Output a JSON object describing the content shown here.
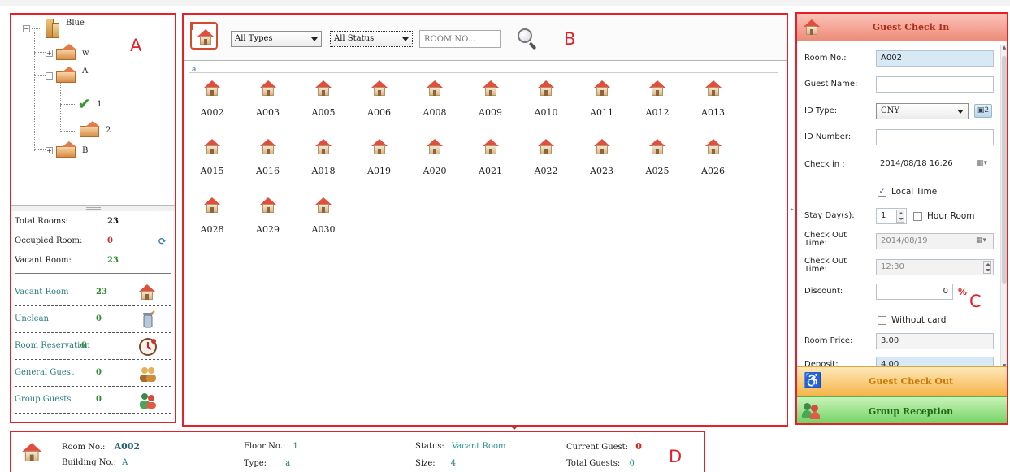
{
  "tree": {
    "building": "Blue",
    "floors": [
      {
        "label": "w"
      },
      {
        "label": "A"
      },
      {
        "label": "1"
      },
      {
        "label": "2"
      },
      {
        "label": "B"
      }
    ]
  },
  "summary": {
    "total_rooms_label": "Total Rooms:",
    "total_rooms": "23",
    "occupied_label": "Occupied Room:",
    "occupied": "0",
    "vacant_label": "Vacant Room:",
    "vacant": "23"
  },
  "categories": [
    {
      "label": "Vacant Room",
      "count": "23",
      "icon": "house-icon"
    },
    {
      "label": "Unclean",
      "count": "0",
      "icon": "trash-icon"
    },
    {
      "label": "Room Reservation",
      "count": "0",
      "icon": "clock-icon"
    },
    {
      "label": "General Guest",
      "count": "0",
      "icon": "guests-icon"
    },
    {
      "label": "Group Guests",
      "count": "0",
      "icon": "group-icon"
    }
  ],
  "toolbar": {
    "type_select": "All Types",
    "status_select": "All Status",
    "room_placeholder": "ROOM NO..."
  },
  "room_group": "a",
  "rooms": [
    "A002",
    "A003",
    "A005",
    "A006",
    "A008",
    "A009",
    "A010",
    "A011",
    "A012",
    "A013",
    "A015",
    "A016",
    "A018",
    "A019",
    "A020",
    "A021",
    "A022",
    "A023",
    "A025",
    "A026",
    "A028",
    "A029",
    "A030"
  ],
  "checkin": {
    "title": "Guest Check In",
    "room_no_label": "Room No.:",
    "room_no": "A002",
    "guest_name_label": "Guest Name:",
    "guest_name": "",
    "id_type_label": "ID Type:",
    "id_type": "CNY",
    "id_number_label": "ID Number:",
    "id_number": "",
    "check_in_label": "Check in :",
    "check_in": "2014/08/18 16:26",
    "local_time_label": "Local Time",
    "stay_days_label": "Stay Day(s):",
    "stay_days": "1",
    "hour_room_label": "Hour Room",
    "check_out_date_label": "Check Out Time:",
    "check_out_date": "2014/08/19",
    "check_out_time_label": "Check Out Time:",
    "check_out_time": "12:30",
    "discount_label": "Discount:",
    "discount": "0",
    "percent_sign": "%",
    "without_card_label": "Without card",
    "room_price_label": "Room Price:",
    "room_price": "3.00",
    "deposit_label": "Deposit:",
    "deposit": "4.00"
  },
  "checkout": {
    "title": "Guest Check Out"
  },
  "group_reception": {
    "title": "Group Reception"
  },
  "details": {
    "room_no_label": "Room No.:",
    "room_no": "A002",
    "building_no_label": "Building No.:",
    "building_no": "A",
    "floor_no_label": "Floor No.:",
    "floor_no": "1",
    "type_label": "Type:",
    "type": "a",
    "status_label": "Status:",
    "status": "Vacant Room",
    "size_label": "Size:",
    "size": "4",
    "current_guest_label": "Current Guest:",
    "current_guest": "0",
    "total_guests_label": "Total Guests:",
    "total_guests": "0"
  },
  "annotations": {
    "a": "A",
    "b": "B",
    "c": "C",
    "d": "D"
  },
  "colors": {
    "annotation_red": "#e5202a",
    "checkin_header": "#ee8b79",
    "checkout_header": "#f6b54a",
    "group_header": "#6ed25f",
    "teal_text": "#2a7d84"
  }
}
